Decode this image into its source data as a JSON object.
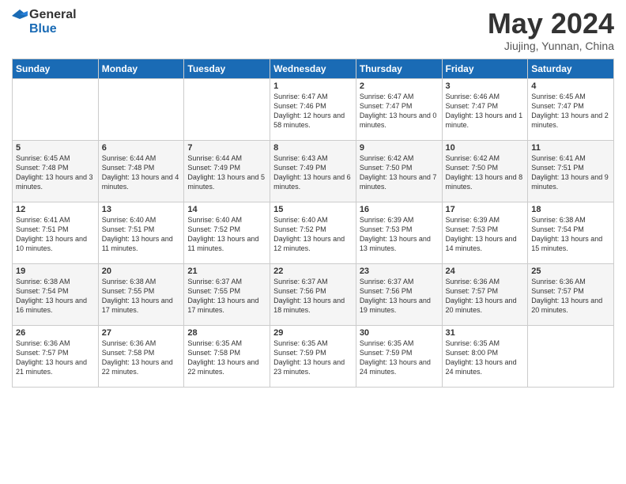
{
  "logo": {
    "general": "General",
    "blue": "Blue"
  },
  "title": "May 2024",
  "subtitle": "Jiujing, Yunnan, China",
  "days_of_week": [
    "Sunday",
    "Monday",
    "Tuesday",
    "Wednesday",
    "Thursday",
    "Friday",
    "Saturday"
  ],
  "weeks": [
    [
      null,
      null,
      null,
      {
        "day": "1",
        "sunrise": "6:47 AM",
        "sunset": "7:46 PM",
        "daylight": "12 hours and 58 minutes."
      },
      {
        "day": "2",
        "sunrise": "6:47 AM",
        "sunset": "7:47 PM",
        "daylight": "13 hours and 0 minutes."
      },
      {
        "day": "3",
        "sunrise": "6:46 AM",
        "sunset": "7:47 PM",
        "daylight": "13 hours and 1 minute."
      },
      {
        "day": "4",
        "sunrise": "6:45 AM",
        "sunset": "7:47 PM",
        "daylight": "13 hours and 2 minutes."
      }
    ],
    [
      {
        "day": "5",
        "sunrise": "6:45 AM",
        "sunset": "7:48 PM",
        "daylight": "13 hours and 3 minutes."
      },
      {
        "day": "6",
        "sunrise": "6:44 AM",
        "sunset": "7:48 PM",
        "daylight": "13 hours and 4 minutes."
      },
      {
        "day": "7",
        "sunrise": "6:44 AM",
        "sunset": "7:49 PM",
        "daylight": "13 hours and 5 minutes."
      },
      {
        "day": "8",
        "sunrise": "6:43 AM",
        "sunset": "7:49 PM",
        "daylight": "13 hours and 6 minutes."
      },
      {
        "day": "9",
        "sunrise": "6:42 AM",
        "sunset": "7:50 PM",
        "daylight": "13 hours and 7 minutes."
      },
      {
        "day": "10",
        "sunrise": "6:42 AM",
        "sunset": "7:50 PM",
        "daylight": "13 hours and 8 minutes."
      },
      {
        "day": "11",
        "sunrise": "6:41 AM",
        "sunset": "7:51 PM",
        "daylight": "13 hours and 9 minutes."
      }
    ],
    [
      {
        "day": "12",
        "sunrise": "6:41 AM",
        "sunset": "7:51 PM",
        "daylight": "13 hours and 10 minutes."
      },
      {
        "day": "13",
        "sunrise": "6:40 AM",
        "sunset": "7:51 PM",
        "daylight": "13 hours and 11 minutes."
      },
      {
        "day": "14",
        "sunrise": "6:40 AM",
        "sunset": "7:52 PM",
        "daylight": "13 hours and 11 minutes."
      },
      {
        "day": "15",
        "sunrise": "6:40 AM",
        "sunset": "7:52 PM",
        "daylight": "13 hours and 12 minutes."
      },
      {
        "day": "16",
        "sunrise": "6:39 AM",
        "sunset": "7:53 PM",
        "daylight": "13 hours and 13 minutes."
      },
      {
        "day": "17",
        "sunrise": "6:39 AM",
        "sunset": "7:53 PM",
        "daylight": "13 hours and 14 minutes."
      },
      {
        "day": "18",
        "sunrise": "6:38 AM",
        "sunset": "7:54 PM",
        "daylight": "13 hours and 15 minutes."
      }
    ],
    [
      {
        "day": "19",
        "sunrise": "6:38 AM",
        "sunset": "7:54 PM",
        "daylight": "13 hours and 16 minutes."
      },
      {
        "day": "20",
        "sunrise": "6:38 AM",
        "sunset": "7:55 PM",
        "daylight": "13 hours and 17 minutes."
      },
      {
        "day": "21",
        "sunrise": "6:37 AM",
        "sunset": "7:55 PM",
        "daylight": "13 hours and 17 minutes."
      },
      {
        "day": "22",
        "sunrise": "6:37 AM",
        "sunset": "7:56 PM",
        "daylight": "13 hours and 18 minutes."
      },
      {
        "day": "23",
        "sunrise": "6:37 AM",
        "sunset": "7:56 PM",
        "daylight": "13 hours and 19 minutes."
      },
      {
        "day": "24",
        "sunrise": "6:36 AM",
        "sunset": "7:57 PM",
        "daylight": "13 hours and 20 minutes."
      },
      {
        "day": "25",
        "sunrise": "6:36 AM",
        "sunset": "7:57 PM",
        "daylight": "13 hours and 20 minutes."
      }
    ],
    [
      {
        "day": "26",
        "sunrise": "6:36 AM",
        "sunset": "7:57 PM",
        "daylight": "13 hours and 21 minutes."
      },
      {
        "day": "27",
        "sunrise": "6:36 AM",
        "sunset": "7:58 PM",
        "daylight": "13 hours and 22 minutes."
      },
      {
        "day": "28",
        "sunrise": "6:35 AM",
        "sunset": "7:58 PM",
        "daylight": "13 hours and 22 minutes."
      },
      {
        "day": "29",
        "sunrise": "6:35 AM",
        "sunset": "7:59 PM",
        "daylight": "13 hours and 23 minutes."
      },
      {
        "day": "30",
        "sunrise": "6:35 AM",
        "sunset": "7:59 PM",
        "daylight": "13 hours and 24 minutes."
      },
      {
        "day": "31",
        "sunrise": "6:35 AM",
        "sunset": "8:00 PM",
        "daylight": "13 hours and 24 minutes."
      },
      null
    ]
  ]
}
